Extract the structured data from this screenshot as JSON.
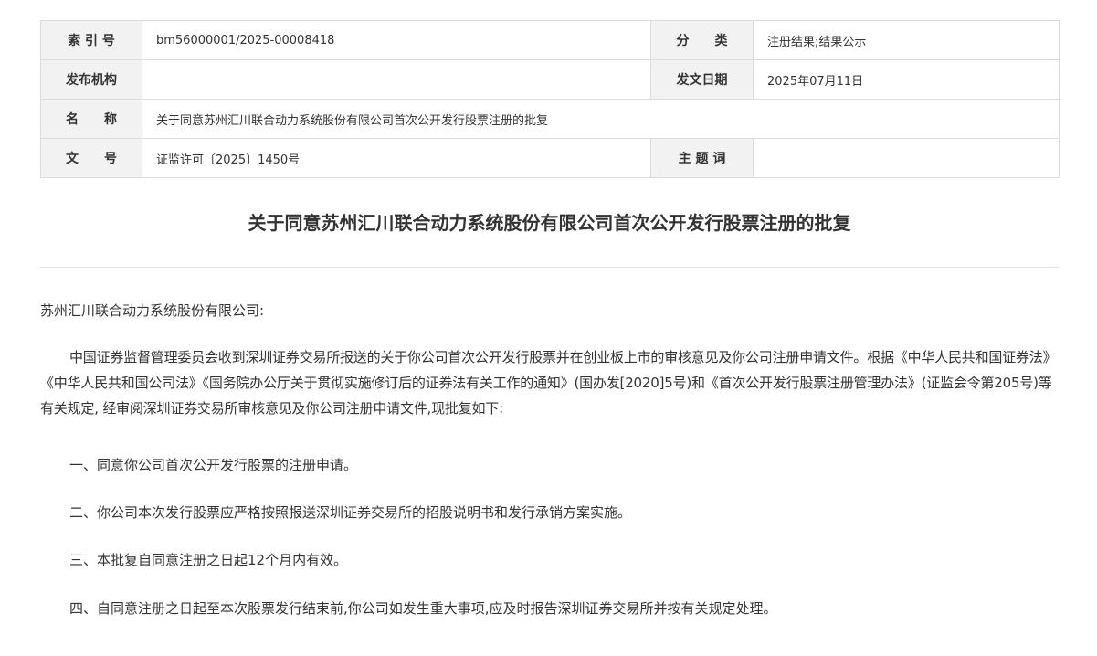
{
  "meta": {
    "index_label": "索 引 号",
    "index_value": "bm56000001/2025-00008418",
    "category_label": "分　　类",
    "category_value": "注册结果;结果公示",
    "publisher_label": "发布机构",
    "publisher_value": "",
    "date_label": "发文日期",
    "date_value": "2025年07月11日",
    "name_label": "名　　称",
    "name_value": "关于同意苏州汇川联合动力系统股份有限公司首次公开发行股票注册的批复",
    "docno_label": "文　　号",
    "docno_value": "证监许可〔2025〕1450号",
    "keywords_label": "主 题 词",
    "keywords_value": ""
  },
  "document": {
    "title": "关于同意苏州汇川联合动力系统股份有限公司首次公开发行股票注册的批复",
    "salutation": "苏州汇川联合动力系统股份有限公司:",
    "paragraph": "中国证券监督管理委员会收到深圳证券交易所报送的关于你公司首次公开发行股票并在创业板上市的审核意见及你公司注册申请文件。根据《中华人民共和国证券法》《中华人民共和国公司法》《国务院办公厅关于贯彻实施修订后的证券法有关工作的通知》(国办发[2020]5号)和《首次公开发行股票注册管理办法》(证监会令第205号)等有关规定, 经审阅深圳证券交易所审核意见及你公司注册申请文件,现批复如下:",
    "items": [
      "一、同意你公司首次公开发行股票的注册申请。",
      "二、你公司本次发行股票应严格按照报送深圳证券交易所的招股说明书和发行承销方案实施。",
      "三、本批复自同意注册之日起12个月内有效。",
      "四、自同意注册之日起至本次股票发行结束前,你公司如发生重大事项,应及时报告深圳证券交易所并按有关规定处理。"
    ]
  }
}
